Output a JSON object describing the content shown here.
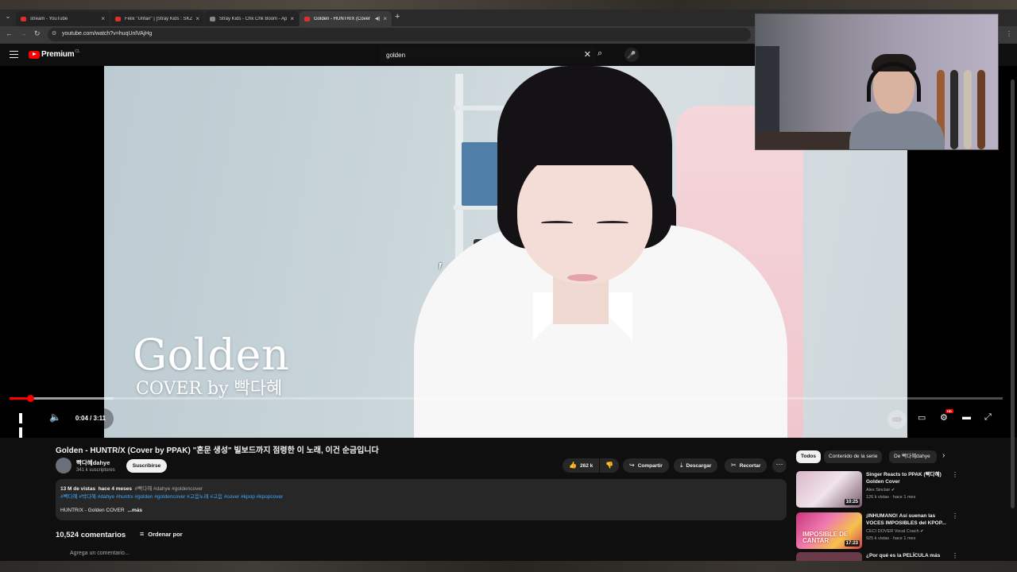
{
  "browser": {
    "tabs": [
      {
        "title": "stream - YouTube"
      },
      {
        "title": "Felix \"Unfair\" | [Stray Kids : SKZ"
      },
      {
        "title": "Stray Kids - Chk Chk Boom - Ap"
      },
      {
        "title": "Golden - HUNTR/X (Cover"
      }
    ],
    "url": "youtube.com/watch?v=huqUnlVAjHg"
  },
  "youtube": {
    "logo_text": "Premium",
    "country": "CL",
    "search_query": "golden"
  },
  "player": {
    "overlay_title": "Golden",
    "overlay_subtitle": "COVER by 빡다혜",
    "time": "0:04 / 3:11",
    "progress_fraction": 0.021,
    "buffered_fraction": 0.105,
    "hd_badge": "HD"
  },
  "video": {
    "title": "Golden - HUNTR/X (Cover by PPAK) \"혼문 생성\" 빌보드까지 점령한 이 노래, 이건 순금입니다",
    "channel": "빡다혜dahye",
    "subscribers": "341 k suscriptores",
    "subscribe_label": "Suscribirse",
    "likes": "262 k",
    "share_label": "Compartir",
    "download_label": "Descargar",
    "clip_label": "Recortar"
  },
  "description": {
    "views": "13 M de vistas",
    "date": "hace 4 meses",
    "tags1": "#빡다혜 #dahye #goldencover",
    "tags2": "#빡다혜 #박다혜 #dahye #huntrx #golden #goldencover #고음노래 #고음 #cover #kpop #kpopcover",
    "line3": "HUNTR/X - Golden COVER",
    "more": "...más"
  },
  "comments": {
    "count": "10,524 comentarios",
    "sort_label": "Ordenar por",
    "placeholder": "Agrega un comentario..."
  },
  "sidebar": {
    "chips": [
      "Todos",
      "Contenido de la serie",
      "De 빡다혜dahye"
    ],
    "recs": [
      {
        "title": "Singer Reacts to PPAK (빡다혜) Golden Cover",
        "channel": "Alex Sinclair",
        "meta": "126 k vistas · hace 1 mes",
        "duration": "10:25"
      },
      {
        "title": "¡INHUMANO! Así suenan las VOCES IMPOSIBLES del KPOP...",
        "channel": "CECI DOVER Vocal Coach",
        "meta": "925 k vistas · hace 1 mes",
        "duration": "17:23",
        "thumb_text": "IMPOSIBLE DE CANTAR"
      },
      {
        "title": "¿Por qué es la PELÍCULA más",
        "channel": "",
        "meta": "",
        "duration": ""
      }
    ]
  },
  "colors": {
    "accent": "#ff0000",
    "link": "#3ea6ff",
    "background": "#0f0f0f"
  }
}
